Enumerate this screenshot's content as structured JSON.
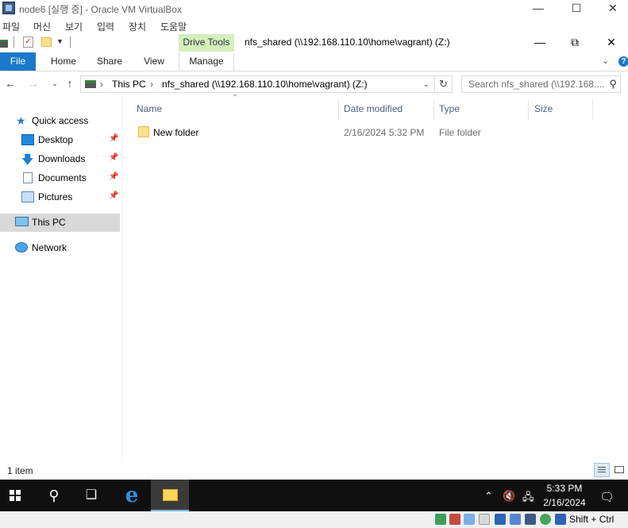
{
  "vbox": {
    "title": "node6 [실행 중] - Oracle VM VirtualBox",
    "menu": [
      "파일",
      "머신",
      "보기",
      "입력",
      "장치",
      "도움말"
    ],
    "host_key": "Shift + Ctrl"
  },
  "explorer": {
    "contextual_tab_group": "Drive Tools",
    "window_title": "nfs_shared (\\\\192.168.110.10\\home\\vagrant) (Z:)",
    "tabs": [
      "File",
      "Home",
      "Share",
      "View",
      "Manage"
    ],
    "address": {
      "crumbs": [
        "This PC",
        "nfs_shared (\\\\192.168.110.10\\home\\vagrant) (Z:)"
      ]
    },
    "search_placeholder": "Search nfs_shared (\\\\192.168....",
    "nav": {
      "quick_access": "Quick access",
      "pinned": [
        "Desktop",
        "Downloads",
        "Documents",
        "Pictures"
      ],
      "this_pc": "This PC",
      "network": "Network"
    },
    "columns": [
      "Name",
      "Date modified",
      "Type",
      "Size"
    ],
    "files": [
      {
        "name": "New folder",
        "date": "2/16/2024 5:32 PM",
        "type": "File folder",
        "size": ""
      }
    ],
    "status": "1 item"
  },
  "taskbar": {
    "time": "5:33 PM",
    "date": "2/16/2024"
  },
  "colors": {
    "accent": "#1979ca",
    "drive_tools": "#d4efbe",
    "selected_nav": "#d9d9d9",
    "taskbar": "#101010"
  }
}
